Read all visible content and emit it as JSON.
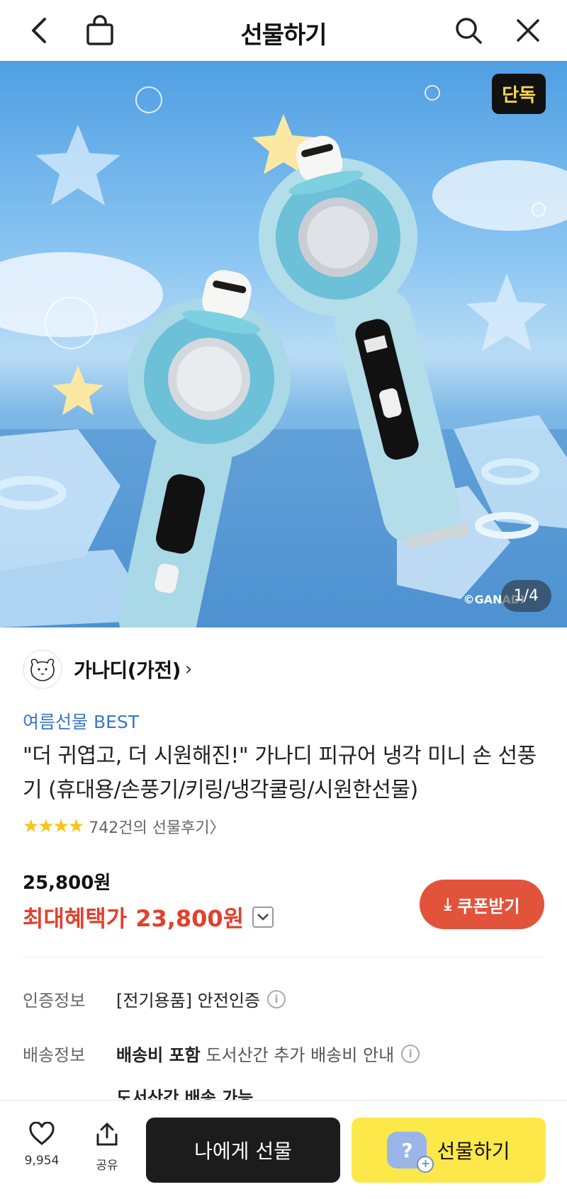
{
  "header": {
    "title": "선물하기",
    "back_icon": "chevron-left-icon",
    "bag_icon": "shopping-bag-icon",
    "search_icon": "search-icon",
    "close_icon": "close-icon"
  },
  "hero": {
    "badge": "단독",
    "pager": "1/4",
    "copyright": "©GANADI"
  },
  "seller": {
    "name": "가나디(가전)",
    "chevron": "›"
  },
  "product": {
    "category": "여름선물 BEST",
    "title": "\"더 귀엽고, 더 시원해진!\" 가나디 피규어 냉각 미니 손 선풍기 (휴대용/손풍기/키링/냉각쿨링/시원한선물)",
    "stars": "★★★★",
    "rating_value": 4,
    "review_link": "742건의 선물후기〉"
  },
  "price": {
    "original": "25,800원",
    "best_label": "최대혜택가",
    "best_amount": "23,800원",
    "coupon_button": "쿠폰받기",
    "coupon_icon": "⤓"
  },
  "info": {
    "cert_label": "인증정보",
    "cert_value": "[전기용품] 안전인증",
    "shipping_label": "배송정보",
    "shipping_bold": "배송비 포함",
    "shipping_note": "도서산간 추가 배송비 안내",
    "shipping_extra": "도서산간 배송 가능",
    "info_icon": "i"
  },
  "bottom_bar": {
    "like_count": "9,954",
    "share_label": "공유",
    "self_gift_button": "나에게 선물",
    "gift_button": "선물하기",
    "gift_icon_char": "?",
    "gift_icon_plus": "+"
  },
  "colors": {
    "accent_red": "#e0412d",
    "coupon_bg": "#e1533a",
    "gift_yellow": "#fde84a",
    "category_blue": "#3a76c9",
    "star_yellow": "#f8c51c"
  }
}
